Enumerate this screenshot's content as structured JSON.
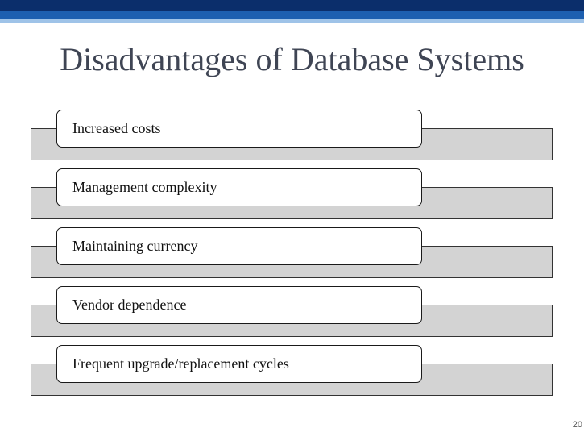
{
  "slide": {
    "title": "Disadvantages of Database Systems",
    "page_number": "20"
  },
  "items": [
    {
      "label": "Increased costs"
    },
    {
      "label": "Management complexity"
    },
    {
      "label": "Maintaining currency"
    },
    {
      "label": "Vendor dependence"
    },
    {
      "label": "Frequent upgrade/replacement cycles"
    }
  ],
  "colors": {
    "header_dark": "#0b2e6b",
    "header_mid": "#1d5fb0",
    "header_light": "#9fc3e8",
    "bar_fill": "#d3d3d3",
    "title_text": "#3f4554"
  }
}
